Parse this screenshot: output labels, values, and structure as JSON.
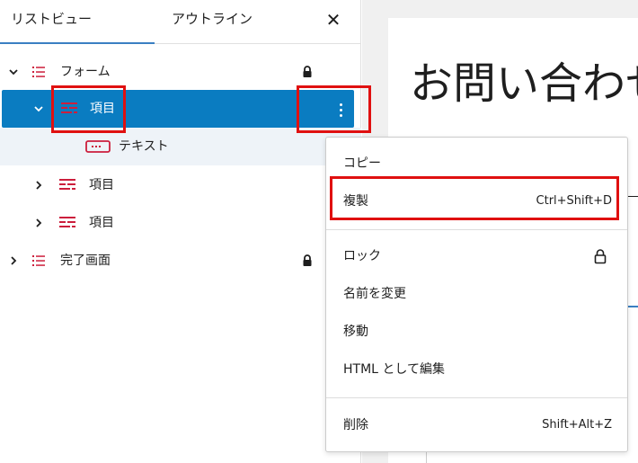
{
  "tabs": {
    "list_view": "リストビュー",
    "outline": "アウトライン",
    "close": "✕"
  },
  "tree": {
    "form_label": "フォーム",
    "item_selected_label": "項目",
    "text_label": "テキスト",
    "item2_label": "項目",
    "item3_label": "項目",
    "complete_label": "完了画面"
  },
  "canvas": {
    "title": "お問い合わせ"
  },
  "menu": {
    "copy": "コピー",
    "duplicate": "複製",
    "duplicate_shortcut": "Ctrl+Shift+D",
    "lock": "ロック",
    "rename": "名前を変更",
    "move": "移動",
    "edit_html": "HTML として編集",
    "delete": "削除",
    "delete_shortcut": "Shift+Alt+Z"
  },
  "colors": {
    "selection": "#0a7cc1",
    "block_icon": "#cc1e3c",
    "annotation": "#e01010",
    "tab_indicator": "#3a7fc2"
  },
  "icons": {
    "list": "list-icon",
    "form_field": "form-field-icon",
    "text_input": "text-input-icon",
    "lock": "lock-icon",
    "more": "more-vertical-icon"
  }
}
